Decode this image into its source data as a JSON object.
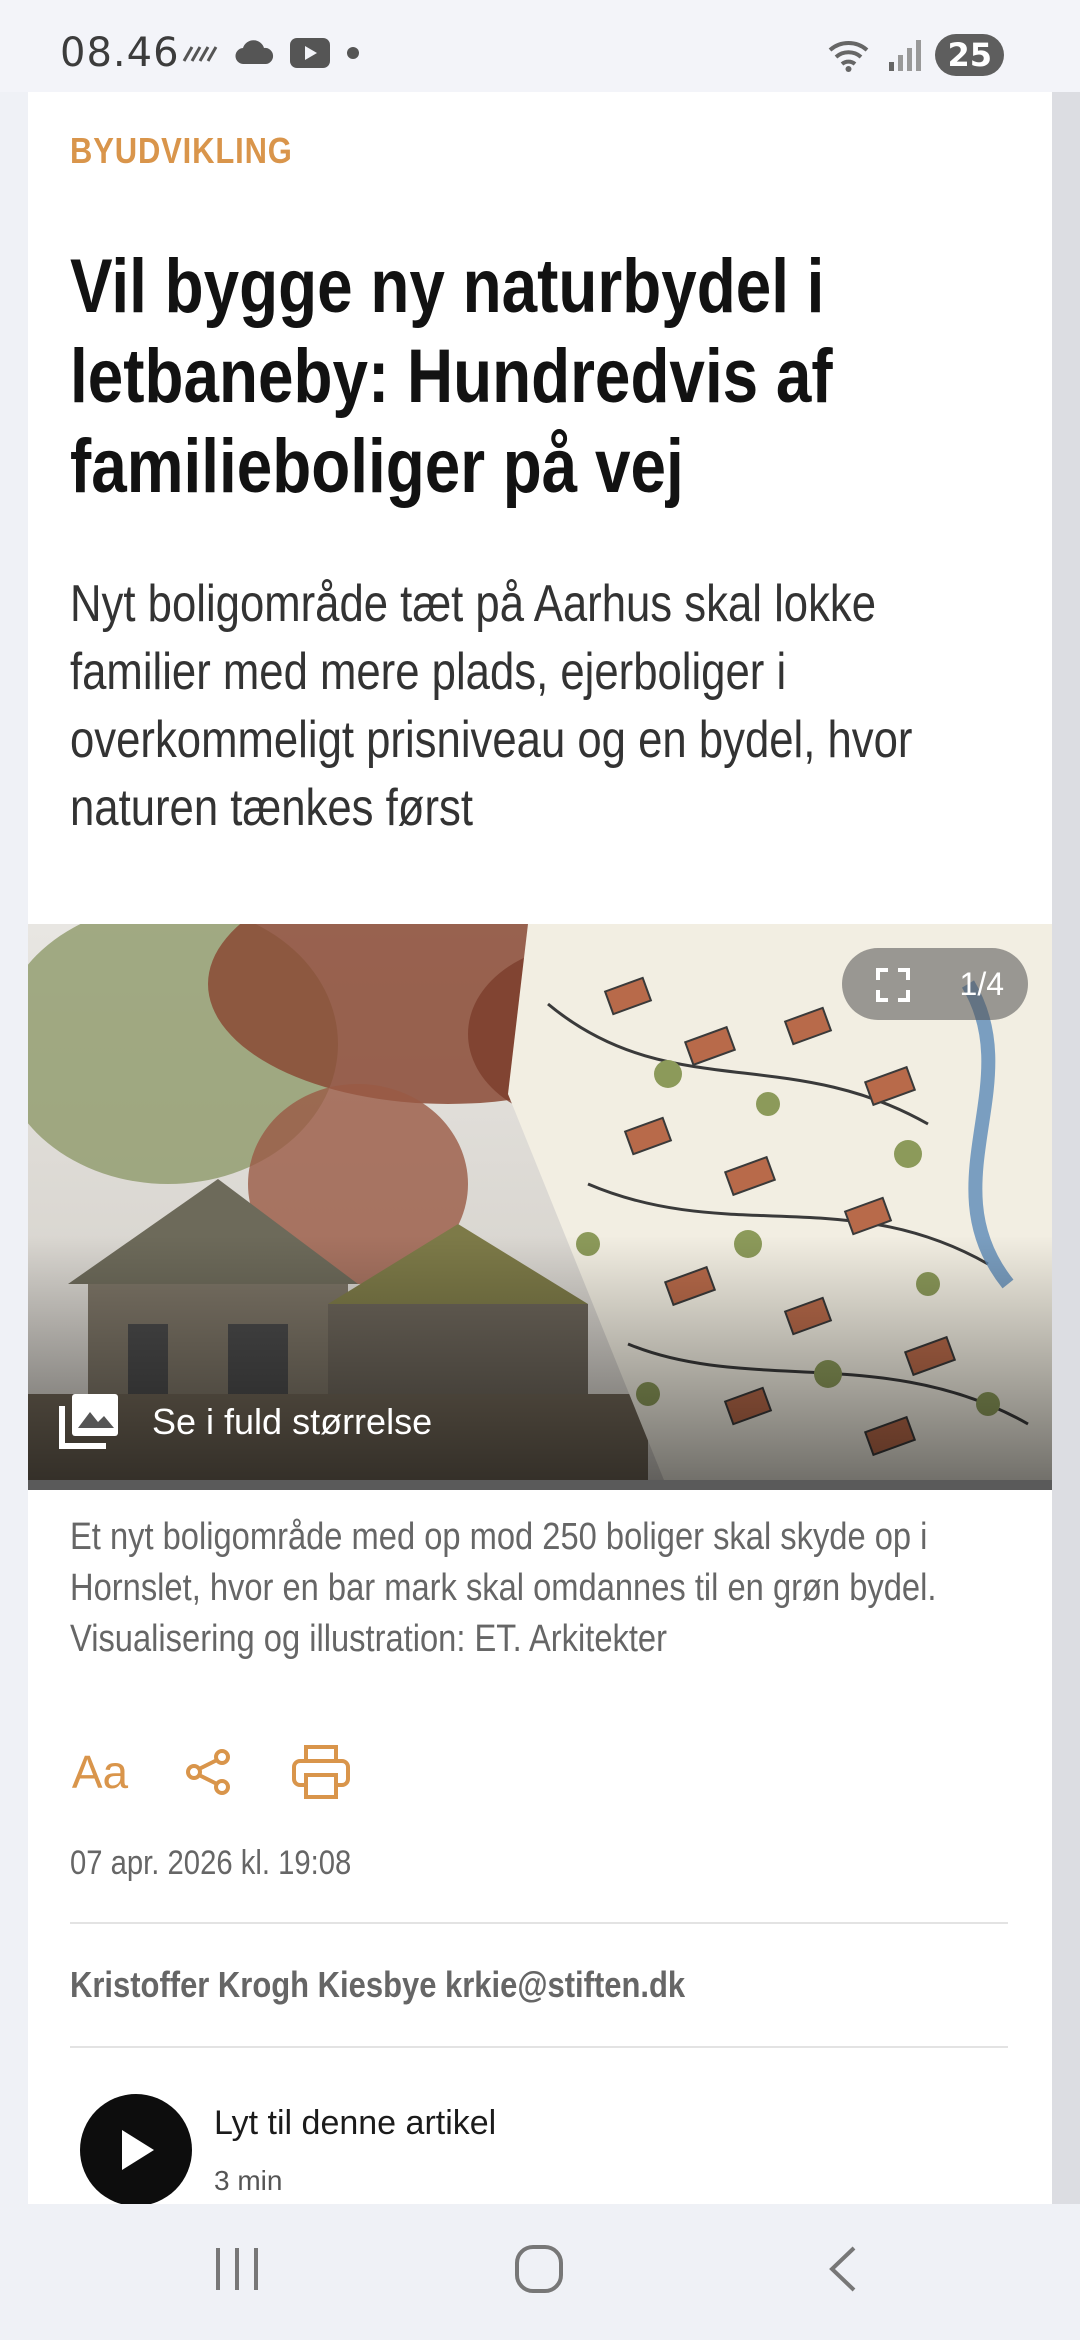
{
  "status_bar": {
    "time": "08.46",
    "battery": "25",
    "icons_left": [
      "wave-icon",
      "cloud-icon",
      "youtube-icon",
      "dot-icon"
    ],
    "icons_right": [
      "wifi-icon",
      "signal-icon"
    ]
  },
  "article": {
    "section": "BYUDVIKLING",
    "headline": "Vil bygge ny naturbydel i letbaneby: Hundredvis af familieboliger på vej",
    "subheadline": "Nyt boligområde tæt på Aarhus skal lokke familier med mere plads, ejerboliger i overkommeligt prisniveau og en bydel, hvor naturen tænkes først",
    "gallery": {
      "counter": "1/4",
      "fullsize_label": "Se i fuld størrelse"
    },
    "caption": "Et nyt boligområde med op mod 250 boliger skal skyde op i Hornslet, hvor en bar mark skal omdannes til en grøn bydel. Visualisering og illustration: ET. Arkitekter",
    "tools": {
      "text_size_label": "Aa"
    },
    "date": "07 apr. 2026 kl. 19:08",
    "author": "Kristoffer Krogh Kiesbye krkie@stiften.dk",
    "listen": {
      "title": "Lyt til denne artikel",
      "duration": "3 min"
    }
  },
  "colors": {
    "accent": "#d9954b",
    "headline": "#121212",
    "muted": "#666666"
  },
  "nav_bar": {
    "buttons": [
      "recents-icon",
      "home-icon",
      "back-icon"
    ]
  }
}
